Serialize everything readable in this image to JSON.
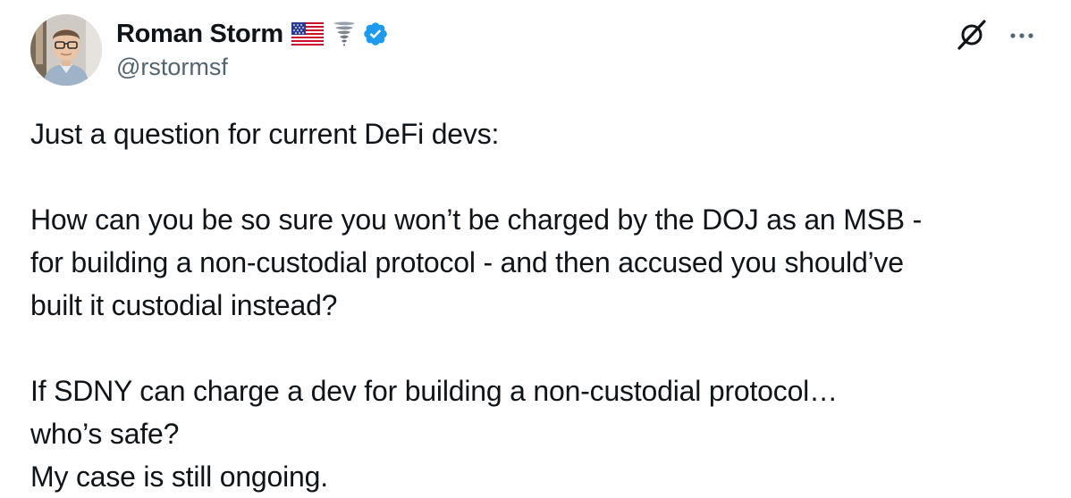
{
  "author": {
    "display_name": "Roman Storm",
    "handle": "@rstormsf",
    "verified": true
  },
  "icons": {
    "flag": "us-flag-icon",
    "tornado": "tornado-icon",
    "verified": "verified-badge-icon",
    "grok": "grok-icon",
    "more": "more-options-icon"
  },
  "colors": {
    "verified": "#1d9bf0",
    "text": "#0f1419",
    "secondary": "#536471"
  },
  "tweet": {
    "lines": [
      "Just a question for current DeFi devs:",
      "",
      "How can you be so sure you won’t be charged by the DOJ as an MSB -",
      "for building a non-custodial protocol - and then accused you should’ve",
      "built it custodial instead?",
      "",
      "If SDNY can charge a dev for building a non-custodial protocol…",
      "who’s safe?",
      "My case is still ongoing."
    ]
  }
}
